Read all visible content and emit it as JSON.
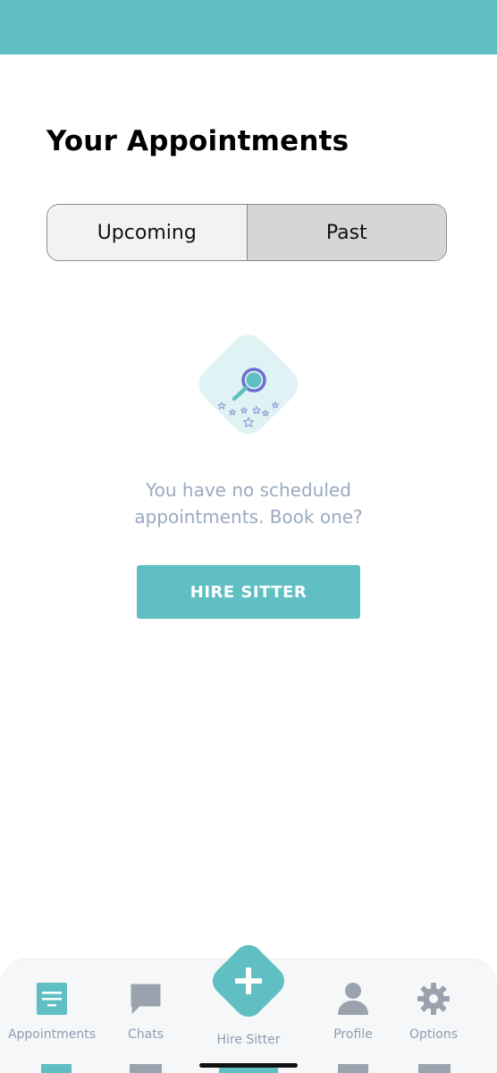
{
  "header": {
    "title": "Your Appointments"
  },
  "tabs": {
    "upcoming_label": "Upcoming",
    "past_label": "Past",
    "selected": "Past"
  },
  "empty_state": {
    "message": "You have no scheduled appointments. Book one?",
    "illustration_icon": "magnifier-stars-icon",
    "hire_button_label": "HIRE SITTER"
  },
  "bottom_nav": {
    "items": [
      {
        "label": "Appointments",
        "icon": "appointments-icon",
        "active": true
      },
      {
        "label": "Chats",
        "icon": "chat-bubble-icon",
        "active": false
      },
      {
        "label": "Hire Sitter",
        "icon": "plus-icon",
        "active": false
      },
      {
        "label": "Profile",
        "icon": "person-icon",
        "active": false
      },
      {
        "label": "Options",
        "icon": "gear-icon",
        "active": false
      }
    ]
  },
  "colors": {
    "accent": "#5fbfc2",
    "muted_text": "#9aaac0",
    "nav_icon": "#8f9cb2"
  }
}
